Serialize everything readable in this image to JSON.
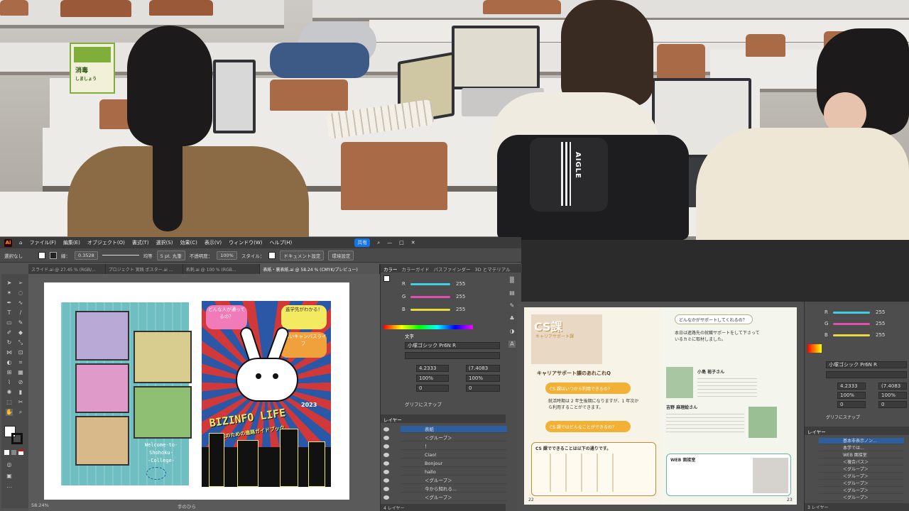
{
  "illustrator": {
    "app_logo": "Ai",
    "menu": [
      "ファイル(F)",
      "編集(E)",
      "オブジェクト(O)",
      "書式(T)",
      "選択(S)",
      "効果(C)",
      "表示(V)",
      "ウィンドウ(W)",
      "ヘルプ(H)"
    ],
    "share_label": "共有",
    "control_bar": {
      "selection": "選択なし",
      "stroke_label": "線：",
      "stroke_value": "0.3528",
      "stroke_style": "均等",
      "brush": "5 pt. 丸筆",
      "opacity_label": "不透明度：",
      "opacity_value": "100%",
      "style_label": "スタイル：",
      "document_setup": "ドキュメント設定",
      "preferences": "環境設定"
    },
    "tabs": [
      "スライド.ai @ 27.45 % (RGB/...",
      "プロジェクト 実践 ポスター.ai ...",
      "名刺.ai @ 100 % (RGB...",
      "表紙・裏表紙.ai @ 58.24 % (CMYK/プレビュー)"
    ],
    "active_tab_index": 3,
    "status_zoom": "58.24%",
    "status_tool": "手のひら",
    "color_panel": {
      "tabs": [
        "カラー",
        "カラーガイド",
        "パスファインダー",
        "3D とマテリアル"
      ],
      "channels": [
        {
          "label": "R",
          "value": "255"
        },
        {
          "label": "G",
          "value": "255"
        },
        {
          "label": "B",
          "value": "255"
        }
      ]
    },
    "character_panel": {
      "title": "文字",
      "font": "小塚ゴシック Pr6N R",
      "size": "4.2333",
      "leading": "(7.4083",
      "vscale": "100%",
      "hscale": "100%",
      "tracking": "0",
      "kerning": "0",
      "snap_label": "グリフにスナップ"
    },
    "layers_panel": {
      "title": "レイヤー",
      "footer": "4 レイヤー",
      "rows": [
        "表紙",
        "＜グループ＞",
        "！",
        "Ciao!",
        "Bonjour",
        "hallo",
        "＜グループ＞",
        "今から知れる...",
        "＜グループ＞"
      ]
    },
    "flyer": {
      "caption": "Welcome to Shohoku College",
      "welcome": "Welcome-to-",
      "shohoku": "Shohoku-",
      "college": "-College-"
    },
    "poster": {
      "title": "BIZINFO LIFE",
      "year": "2023",
      "subtitle": "高校生のための進路ガイドブック",
      "bubbles": [
        "どんな人が通ってるの？",
        "進学先がわかる！",
        "楽しいキャンパスライフ"
      ]
    }
  },
  "second_screen": {
    "header": "CS課",
    "header_sub": "キャリアサポート課",
    "question_heading": "キャリアサポート課のあれこれQ",
    "q1": "CS 課はいつから利用できるの？",
    "a1": "就活時期は 2 年生後期になりますが、1 年次から利用することができます。",
    "q2": "CS 課ではどんなことができるの？",
    "list_heading": "CS 課でできることは以下の通りです。",
    "right_q": "どんなかがサポートしてくれるの？",
    "right_a": "本日は進路先の就職サポートをして下さっているカミに取材しました。",
    "staff1": "小島 裕子さん",
    "staff2": "吉野 麻理絵さん",
    "web_title": "WEB 面接室",
    "page_left": "22",
    "page_right": "23",
    "color_values": [
      "255",
      "255",
      "255"
    ],
    "font": "小塚ゴシック Pr6N R",
    "size": "4.2333",
    "leading": "(7.4083",
    "scale": "100%",
    "tracking": "0",
    "snap_label": "グリフにスナップ",
    "layers_title": "レイヤー",
    "layers_footer": "3 レイヤー",
    "layer_rows": [
      "基本非表示ノン...",
      "本学では...",
      "WEB 面接室",
      "＜複合パス＞",
      "＜グループ＞",
      "＜グループ＞",
      "＜グループ＞",
      "＜グループ＞",
      "＜グループ＞"
    ]
  },
  "classroom": {
    "sign_text": "消毒",
    "sign_sub": "しましょう",
    "bag_brand": "AIGLE"
  },
  "colors": {
    "ai_bg": "#535353",
    "ai_dark": "#3a3a3a",
    "accent_blue": "#2b58a6",
    "teal": "#6fbfc2",
    "cyan_slider": "#3fd0e6",
    "magenta_slider": "#e04fb0",
    "yellow_slider": "#e6d93f"
  }
}
